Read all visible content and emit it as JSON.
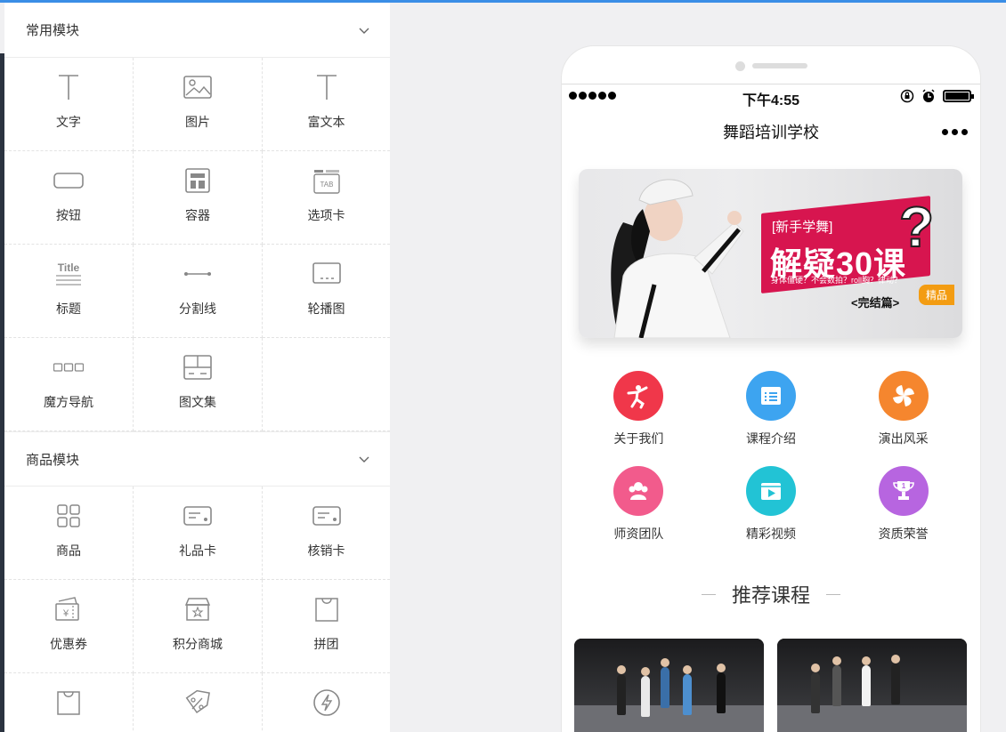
{
  "sidebar": {
    "common_section": {
      "title": "常用模块",
      "items": [
        {
          "label": "文字",
          "icon": "text-icon"
        },
        {
          "label": "图片",
          "icon": "image-icon"
        },
        {
          "label": "富文本",
          "icon": "rich-text-icon"
        },
        {
          "label": "按钮",
          "icon": "button-icon"
        },
        {
          "label": "容器",
          "icon": "container-icon"
        },
        {
          "label": "选项卡",
          "icon": "tab-icon"
        },
        {
          "label": "标题",
          "icon": "title-icon"
        },
        {
          "label": "分割线",
          "icon": "divider-icon"
        },
        {
          "label": "轮播图",
          "icon": "carousel-icon"
        },
        {
          "label": "魔方导航",
          "icon": "cube-nav-icon"
        },
        {
          "label": "图文集",
          "icon": "gallery-icon"
        }
      ]
    },
    "goods_section": {
      "title": "商品模块",
      "items": [
        {
          "label": "商品",
          "icon": "goods-grid-icon"
        },
        {
          "label": "礼品卡",
          "icon": "gift-card-icon"
        },
        {
          "label": "核销卡",
          "icon": "verify-card-icon"
        },
        {
          "label": "优惠券",
          "icon": "coupon-icon"
        },
        {
          "label": "积分商城",
          "icon": "points-mall-icon"
        },
        {
          "label": "拼团",
          "icon": "group-buy-icon"
        },
        {
          "label": "",
          "icon": "bag-icon"
        },
        {
          "label": "",
          "icon": "discount-tag-icon"
        },
        {
          "label": "",
          "icon": "flash-sale-icon"
        }
      ]
    }
  },
  "phone": {
    "status": {
      "time": "下午4:55"
    },
    "nav_title": "舞蹈培训学校",
    "banner": {
      "tag": "[新手学舞]",
      "headline": "解疑30课",
      "subline": "身体僵硬？不会数拍？roll胸？律动？",
      "ending": "<完结篇>",
      "badge": "精品",
      "qmark": "?"
    },
    "icon_grid": [
      {
        "label": "关于我们",
        "color": "#f0374a",
        "icon": "dancer-icon"
      },
      {
        "label": "课程介绍",
        "color": "#3da4f0",
        "icon": "list-icon"
      },
      {
        "label": "演出风采",
        "color": "#f5862e",
        "icon": "flower-icon"
      },
      {
        "label": "师资团队",
        "color": "#f25b8c",
        "icon": "team-icon"
      },
      {
        "label": "精彩视频",
        "color": "#22c3d5",
        "icon": "video-icon"
      },
      {
        "label": "资质荣誉",
        "color": "#b765e0",
        "icon": "trophy-icon"
      }
    ],
    "recommend_title": "推荐课程"
  },
  "colors": {
    "accent": "#3a8ee6",
    "banner_red": "#d7154f",
    "badge_orange": "#f39c12"
  }
}
